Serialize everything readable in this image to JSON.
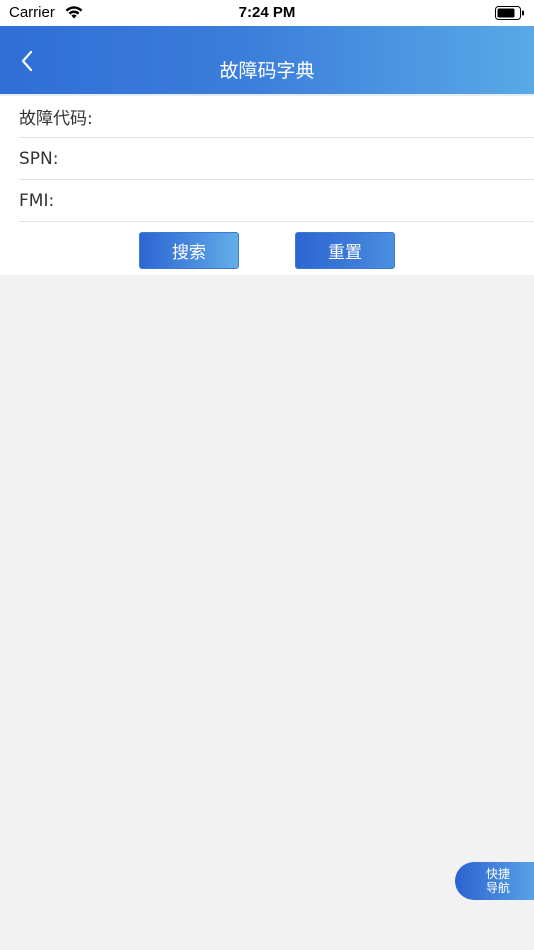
{
  "status_bar": {
    "carrier": "Carrier",
    "time": "7:24 PM"
  },
  "nav_bar": {
    "title": "故障码字典",
    "back_icon": "chevron-left-icon"
  },
  "form": {
    "fault_code_label": "故障代码:",
    "fault_code_value": "",
    "spn_label": "SPN:",
    "spn_value": "",
    "fmi_label": "FMI:",
    "fmi_value": ""
  },
  "buttons": {
    "search_label": "搜索",
    "reset_label": "重置"
  },
  "quick_nav": {
    "line1": "快捷",
    "line2": "导航"
  },
  "colors": {
    "nav_gradient_start": "#2f6fd6",
    "nav_gradient_end": "#58a9e6",
    "page_background": "#f2f2f2"
  }
}
